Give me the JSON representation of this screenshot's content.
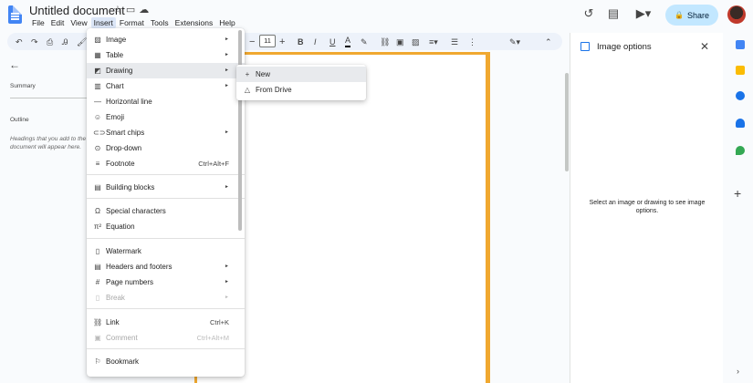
{
  "header": {
    "doc_title": "Untitled document",
    "menus": [
      "File",
      "Edit",
      "View",
      "Insert",
      "Format",
      "Tools",
      "Extensions",
      "Help"
    ],
    "active_menu": "Insert",
    "share_label": "Share"
  },
  "toolbar": {
    "font_size": "11"
  },
  "outline_panel": {
    "summary_label": "Summary",
    "outline_label": "Outline",
    "outline_hint": "Headings that you add to the document will appear here."
  },
  "insert_menu": {
    "items": [
      {
        "icon": "image-icon",
        "label": "Image",
        "submenu": true
      },
      {
        "icon": "table-icon",
        "label": "Table",
        "submenu": true
      },
      {
        "icon": "drawing-icon",
        "label": "Drawing",
        "submenu": true,
        "hover": true
      },
      {
        "icon": "chart-icon",
        "label": "Chart",
        "submenu": true
      },
      {
        "icon": "horizontal-line-icon",
        "label": "Horizontal line"
      },
      {
        "icon": "emoji-icon",
        "label": "Emoji"
      },
      {
        "icon": "smart-chips-icon",
        "label": "Smart chips",
        "submenu": true
      },
      {
        "icon": "dropdown-icon",
        "label": "Drop-down"
      },
      {
        "icon": "footnote-icon",
        "label": "Footnote",
        "shortcut": "Ctrl+Alt+F"
      },
      {
        "icon": "building-blocks-icon",
        "label": "Building blocks",
        "submenu": true
      },
      {
        "icon": "omega-icon",
        "label": "Special characters"
      },
      {
        "icon": "equation-icon",
        "label": "Equation"
      },
      {
        "icon": "watermark-icon",
        "label": "Watermark"
      },
      {
        "icon": "headers-footers-icon",
        "label": "Headers and footers",
        "submenu": true
      },
      {
        "icon": "page-numbers-icon",
        "label": "Page numbers",
        "submenu": true
      },
      {
        "icon": "break-icon",
        "label": "Break",
        "submenu": true,
        "disabled": true
      },
      {
        "icon": "link-icon",
        "label": "Link",
        "shortcut": "Ctrl+K"
      },
      {
        "icon": "comment-icon",
        "label": "Comment",
        "shortcut": "Ctrl+Alt+M",
        "disabled": true
      },
      {
        "icon": "bookmark-icon",
        "label": "Bookmark"
      }
    ]
  },
  "drawing_submenu": {
    "new_label": "New",
    "from_drive_label": "From Drive"
  },
  "image_options": {
    "title": "Image options",
    "message": "Select an image or drawing to see image options."
  },
  "colors": {
    "accent": "#1a73e8",
    "share_bg": "#c2e7ff",
    "page_border": "#f0a830"
  }
}
